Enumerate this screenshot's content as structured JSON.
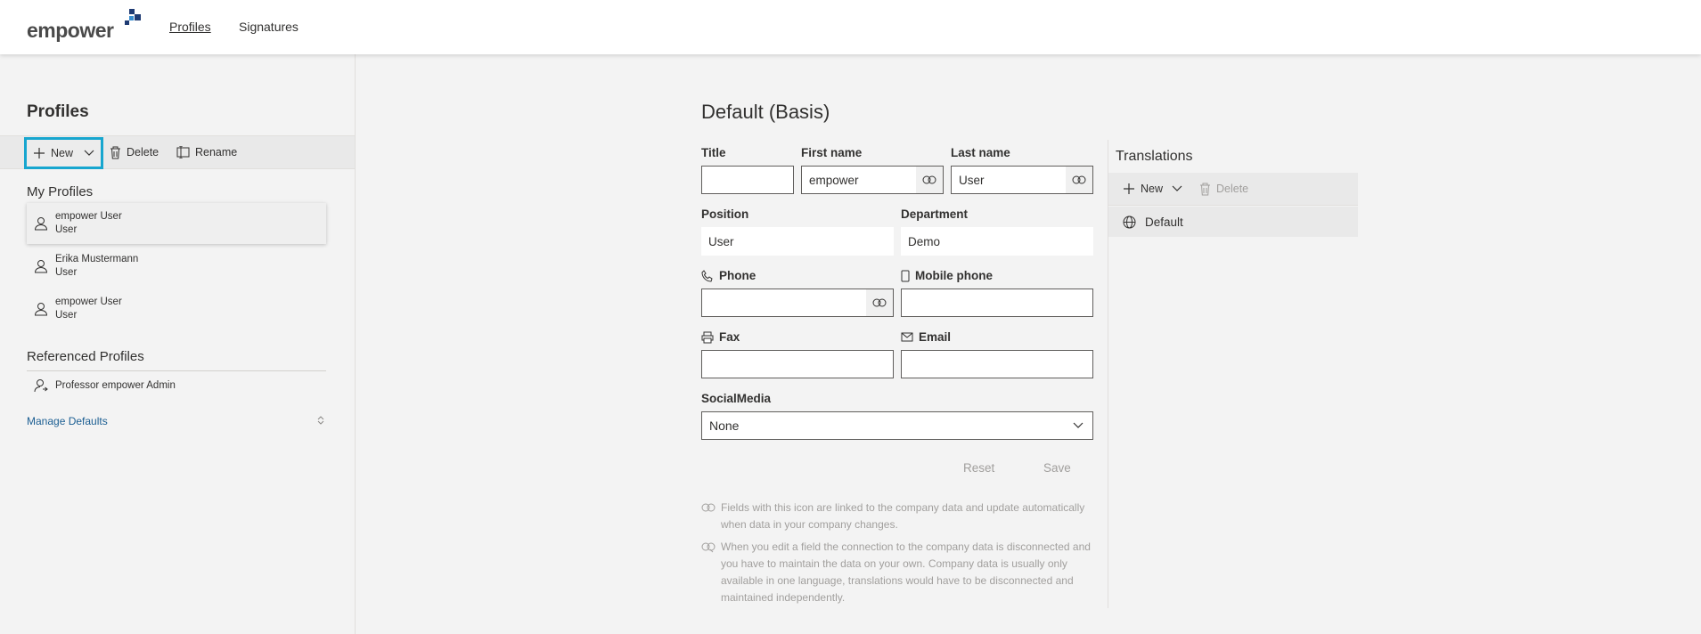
{
  "app": {
    "logo_text": "empower"
  },
  "nav": {
    "profiles": "Profiles",
    "signatures": "Signatures"
  },
  "left": {
    "title": "Profiles",
    "toolbar": {
      "new": "New",
      "delete": "Delete",
      "rename": "Rename"
    },
    "my_profiles_title": "My Profiles",
    "my_profiles": [
      {
        "name": "empower User",
        "role": "User"
      },
      {
        "name": "Erika Mustermann",
        "role": "User"
      },
      {
        "name": "empower User",
        "role": "User"
      }
    ],
    "referenced_title": "Referenced Profiles",
    "referenced": [
      {
        "name": "Professor empower Admin"
      }
    ],
    "manage_defaults": "Manage Defaults"
  },
  "form": {
    "title": "Default (Basis)",
    "labels": {
      "title": "Title",
      "first_name": "First name",
      "last_name": "Last name",
      "position": "Position",
      "department": "Department",
      "phone": "Phone",
      "mobile": "Mobile phone",
      "fax": "Fax",
      "email": "Email",
      "social": "SocialMedia"
    },
    "values": {
      "title": "",
      "first_name": "empower",
      "last_name": "User",
      "position": "User",
      "department": "Demo",
      "phone": "",
      "mobile": "",
      "fax": "",
      "email": ""
    },
    "social_selected": "None",
    "reset": "Reset",
    "save": "Save",
    "hint1": "Fields with this icon are linked to the company data and update automatically when data in your company changes.",
    "hint2": "When you edit a field the connection to the company data is disconnected and you have to maintain the data on your own. Company data is usually only available in one language, translations would have to be disconnected and maintained independently."
  },
  "translations": {
    "title": "Translations",
    "new": "New",
    "delete": "Delete",
    "items": [
      {
        "label": "Default"
      }
    ]
  },
  "colors": {
    "accent_highlight": "#17a6cf",
    "brand_blue": "#1f3b73",
    "link": "#1b5e92"
  }
}
